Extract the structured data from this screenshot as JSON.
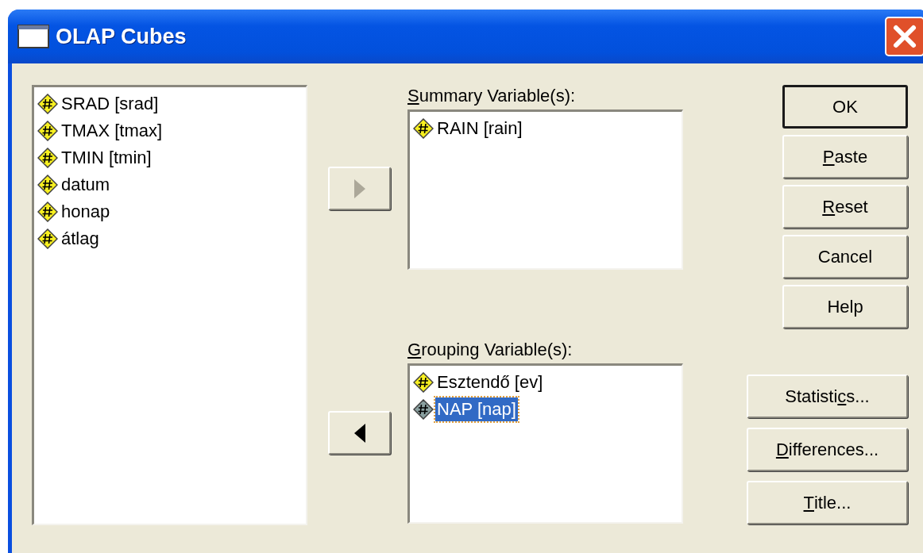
{
  "window": {
    "title": "OLAP Cubes"
  },
  "source_list": {
    "items": [
      {
        "label": "SRAD [srad]",
        "selected": false
      },
      {
        "label": "TMAX [tmax]",
        "selected": false
      },
      {
        "label": "TMIN [tmin]",
        "selected": false
      },
      {
        "label": "datum",
        "selected": false
      },
      {
        "label": "honap",
        "selected": false
      },
      {
        "label": "átlag",
        "selected": false
      }
    ]
  },
  "move_buttons": [
    {
      "kind": "right",
      "disabled": true
    },
    {
      "kind": "left",
      "disabled": false
    }
  ],
  "target_lists": [
    {
      "label": [
        {
          "text": "S",
          "underline": true
        },
        {
          "text": "ummary Variable(s):",
          "underline": false
        }
      ],
      "items": [
        {
          "label": "RAIN [rain]",
          "selected": false
        }
      ]
    },
    {
      "label": [
        {
          "text": "G",
          "underline": true
        },
        {
          "text": "rouping Variable(s):",
          "underline": false
        }
      ],
      "items": [
        {
          "label": "Esztendő [ev]",
          "selected": false
        },
        {
          "label": "NAP [nap]",
          "selected": true
        }
      ]
    }
  ],
  "action_buttons": [
    {
      "label": [
        {
          "text": "OK",
          "underline": false
        }
      ],
      "default": true
    },
    {
      "label": [
        {
          "text": "P",
          "underline": true
        },
        {
          "text": "aste",
          "underline": false
        }
      ],
      "default": false
    },
    {
      "label": [
        {
          "text": "R",
          "underline": true
        },
        {
          "text": "eset",
          "underline": false
        }
      ],
      "default": false
    },
    {
      "label": [
        {
          "text": "Cancel",
          "underline": false
        }
      ],
      "default": false
    },
    {
      "label": [
        {
          "text": "Help",
          "underline": false
        }
      ],
      "default": false
    }
  ],
  "option_buttons": [
    {
      "label": [
        {
          "text": "Statisti",
          "underline": false
        },
        {
          "text": "c",
          "underline": true
        },
        {
          "text": "s...",
          "underline": false
        }
      ]
    },
    {
      "label": [
        {
          "text": "D",
          "underline": true
        },
        {
          "text": "ifferences...",
          "underline": false
        }
      ]
    },
    {
      "label": [
        {
          "text": "T",
          "underline": true
        },
        {
          "text": "itle...",
          "underline": false
        }
      ]
    }
  ]
}
